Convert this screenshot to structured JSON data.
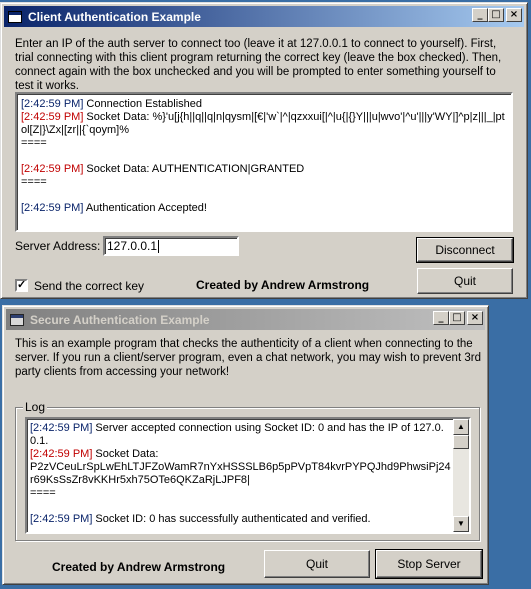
{
  "client": {
    "title": "Client Authentication Example",
    "description": "Enter an IP of the auth server to connect too (leave it at 127.0.0.1 to connect to yourself). First, trial connecting with this client program returning the correct key (leave the box checked). Then, connect again with the box unchecked and you will be prompted to enter something yourself to test it works.",
    "log": [
      {
        "time": "[2:42:59 PM]",
        "color": "blue",
        "text": " Connection Established"
      },
      {
        "time": "[2:42:59 PM]",
        "color": "red",
        "text": " Socket Data: %}'u[j{h||q||q|n|qysm|[€|'w`|^|qzxxui[|^|u{|{}Y|||u|wvo'|^u'|||y'WY|]^p|z|||_|ptol[Z|}\\Zx|[zr||{`qoym]%"
      },
      {
        "time": "",
        "color": "",
        "text": "===="
      },
      {
        "time": "",
        "color": "",
        "text": ""
      },
      {
        "time": "[2:42:59 PM]",
        "color": "red",
        "text": " Socket Data: AUTHENTICATION|GRANTED"
      },
      {
        "time": "",
        "color": "",
        "text": "===="
      },
      {
        "time": "",
        "color": "",
        "text": ""
      },
      {
        "time": "[2:42:59 PM]",
        "color": "blue",
        "text": " Authentication Accepted!"
      }
    ],
    "server_address_label": "Server Address:",
    "server_address_value": "127.0.0.1",
    "disconnect_label": "Disconnect",
    "quit_label": "Quit",
    "send_key_label": "Send the correct key",
    "send_key_checked": true,
    "credit": "Created by Andrew Armstrong"
  },
  "server": {
    "title": "Secure Authentication Example",
    "description": "This is an example program that checks the authenticity of a client when connecting to the server. If you run a client/server program, even a chat network, you may wish to prevent 3rd party clients from accessing your network!",
    "log_group_label": "Log",
    "log": [
      {
        "time": "[2:42:59 PM]",
        "color": "blue",
        "text": " Server accepted connection using Socket ID: 0 and has the IP of 127.0.0.1."
      },
      {
        "time": "[2:42:59 PM]",
        "color": "red",
        "text": " Socket Data:"
      },
      {
        "time": "",
        "color": "",
        "text": "P2zVCeuLrSpLwEhLTJFZoWamR7nYxHSSSLB6p5pPVpT84kvrPYPQJhd9PhwsiPj24r69KsSsZr8vKKHr5xh75OTe6QKZaRjLJPF8|"
      },
      {
        "time": "",
        "color": "",
        "text": "===="
      },
      {
        "time": "",
        "color": "",
        "text": ""
      },
      {
        "time": "[2:42:59 PM]",
        "color": "blue",
        "text": " Socket ID: 0 has successfully authenticated and verified."
      }
    ],
    "quit_label": "Quit",
    "stop_label": "Stop Server",
    "credit": "Created by Andrew Armstrong"
  },
  "titlebar_buttons": {
    "minimize": "_",
    "maximize": "□",
    "close": "×"
  }
}
